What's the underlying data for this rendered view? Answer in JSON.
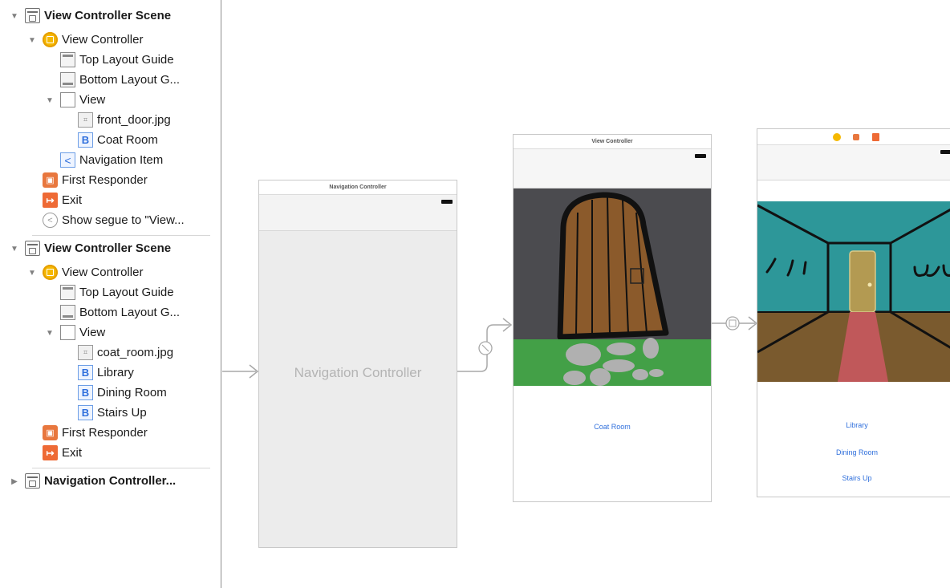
{
  "outline": {
    "scene1": {
      "title": "View Controller Scene",
      "items": [
        "View Controller",
        "Top Layout Guide",
        "Bottom Layout G...",
        "View",
        "front_door.jpg",
        "Coat Room",
        "Navigation Item",
        "First Responder",
        "Exit",
        "Show segue to \"View..."
      ]
    },
    "scene2": {
      "title": "View Controller Scene",
      "items": [
        "View Controller",
        "Top Layout Guide",
        "Bottom Layout G...",
        "View",
        "coat_room.jpg",
        "Library",
        "Dining Room",
        "Stairs Up",
        "First Responder",
        "Exit"
      ]
    },
    "scene3": {
      "title": "Navigation Controller..."
    }
  },
  "canvas": {
    "nav_controller": {
      "title": "Navigation Controller",
      "body_label": "Navigation Controller"
    },
    "vc1": {
      "title": "View Controller",
      "button": "Coat Room"
    },
    "vc2": {
      "buttons": [
        "Library",
        "Dining Room",
        "Stairs Up"
      ]
    }
  },
  "icons": {
    "disclosure_open": "▼",
    "disclosure_closed": "▶",
    "button_glyph": "B",
    "nav_item_glyph": "<",
    "segue_glyph": "<"
  },
  "colors": {
    "accent_blue": "#2f6fdc",
    "vc_yellow": "#f5b800",
    "exit_orange": "#ee6a35",
    "door_brown": "#8b5a2b",
    "room_teal": "#2d9799"
  }
}
